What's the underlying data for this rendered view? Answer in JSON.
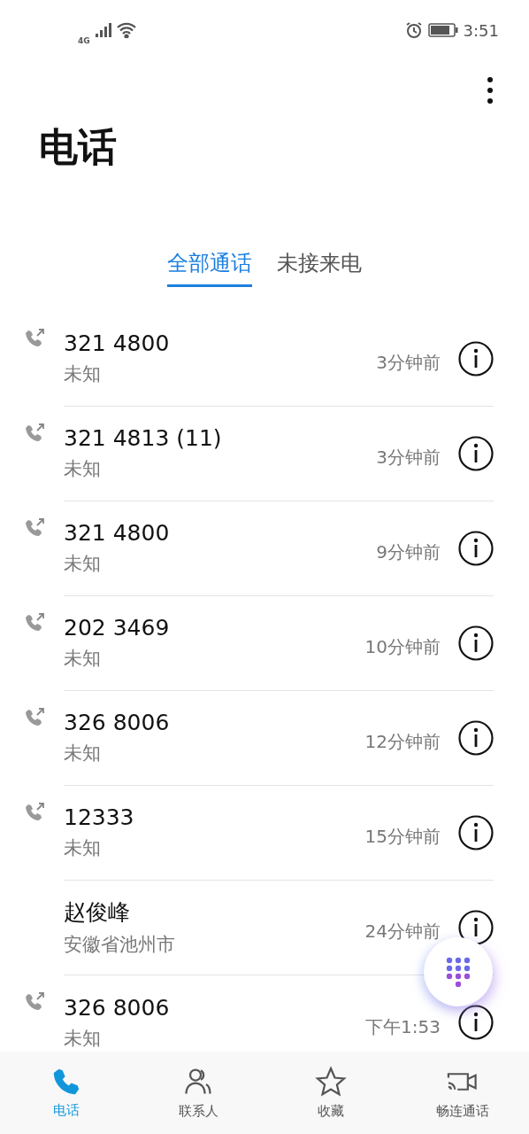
{
  "status_bar": {
    "network": "4G",
    "time": "3:51"
  },
  "title": "电话",
  "tabs": [
    {
      "label": "全部通话",
      "selected": true
    },
    {
      "label": "未接来电",
      "selected": false
    }
  ],
  "calls": [
    {
      "name": "321 4800",
      "location": "未知",
      "time": "3分钟前",
      "outgoing": true
    },
    {
      "name": "321 4813 (11)",
      "location": "未知",
      "time": "3分钟前",
      "outgoing": true
    },
    {
      "name": "321 4800",
      "location": "未知",
      "time": "9分钟前",
      "outgoing": true
    },
    {
      "name": "202 3469",
      "location": "未知",
      "time": "10分钟前",
      "outgoing": true
    },
    {
      "name": "326 8006",
      "location": "未知",
      "time": "12分钟前",
      "outgoing": true
    },
    {
      "name": "12333",
      "location": "未知",
      "time": "15分钟前",
      "outgoing": true
    },
    {
      "name": "赵俊峰",
      "location": "安徽省池州市",
      "time": "24分钟前",
      "outgoing": false
    },
    {
      "name": "326 8006",
      "location": "未知",
      "time": "下午1:53",
      "outgoing": true
    }
  ],
  "bottom_nav": [
    {
      "label": "电话",
      "selected": true
    },
    {
      "label": "联系人",
      "selected": false
    },
    {
      "label": "收藏",
      "selected": false
    },
    {
      "label": "畅连通话",
      "selected": false
    }
  ]
}
